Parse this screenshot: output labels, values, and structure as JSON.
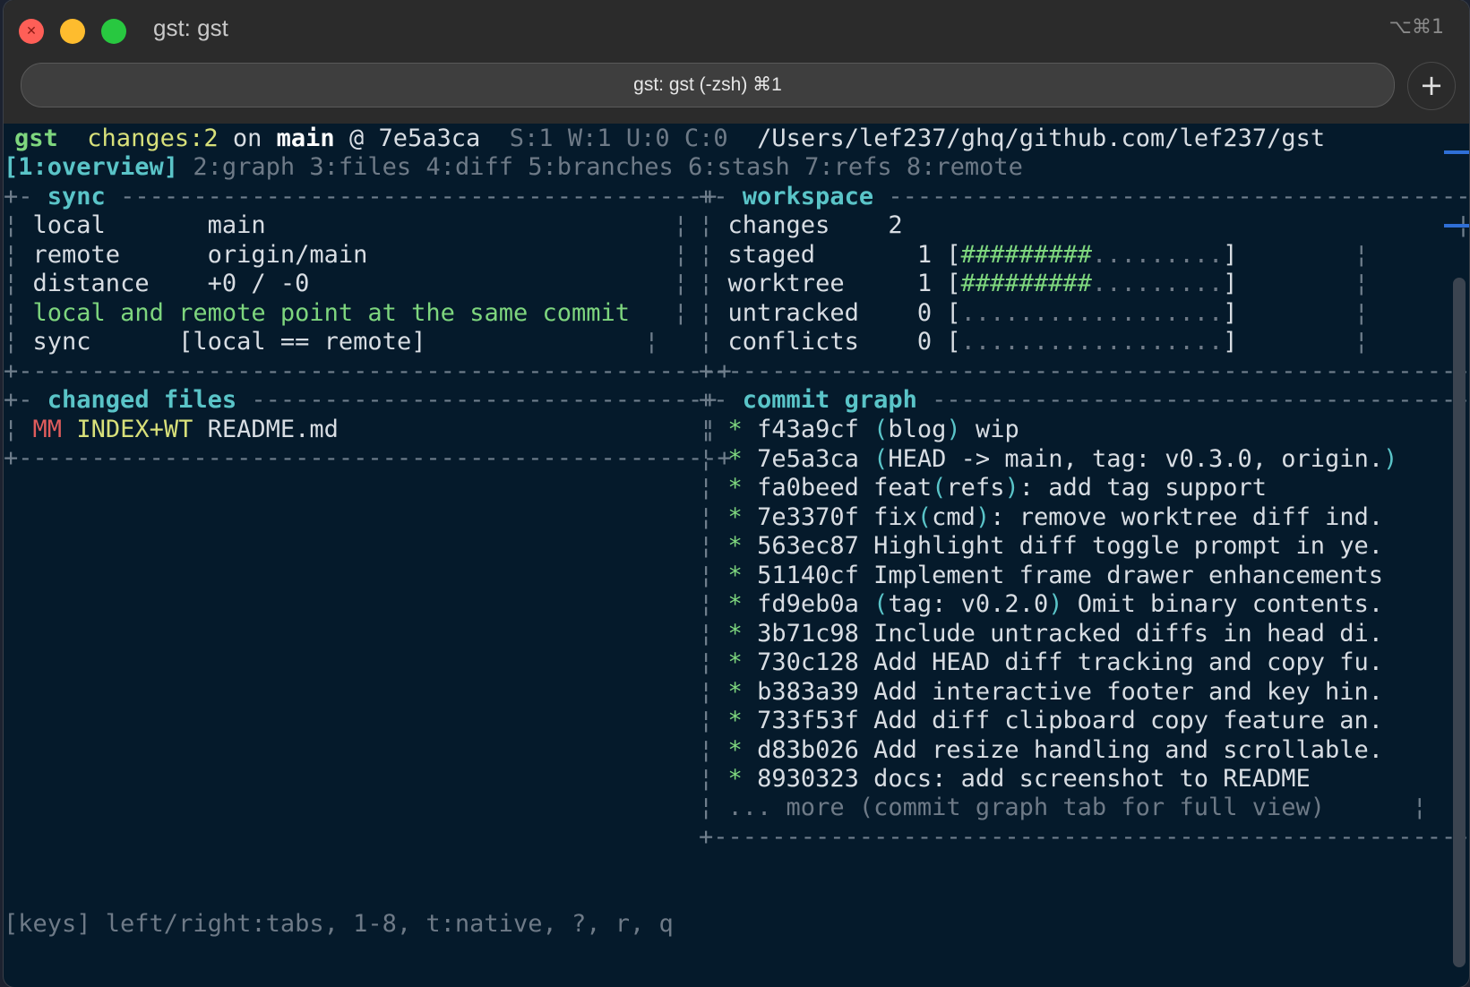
{
  "window": {
    "title": "gst: gst",
    "shortcut": "⌥⌘1",
    "tab_label": "gst: gst (-zsh) ⌘1",
    "new_tab": "+"
  },
  "status": {
    "app": "gst",
    "changes": "changes:2",
    "on": "on",
    "branch": "main",
    "at": "@",
    "commit": "7e5a3ca",
    "counts": "S:1 W:1 U:0 C:0",
    "path": "/Users/lef237/ghq/github.com/lef237/gst"
  },
  "tabs": {
    "active": "[1:overview]",
    "inactive": "2:graph 3:files 4:diff 5:branches 6:stash 7:refs 8:remote"
  },
  "sync": {
    "title": "sync",
    "rows": [
      {
        "key": "local",
        "value": "main"
      },
      {
        "key": "remote",
        "value": "origin/main"
      },
      {
        "key": "distance",
        "value": "+0 / -0"
      }
    ],
    "message": "local and remote point at the same commit",
    "sync_key": "sync",
    "sync_value": "[local == remote]"
  },
  "workspace": {
    "title": "workspace",
    "changes_key": "changes",
    "changes_value": "2",
    "bars": [
      {
        "key": "staged",
        "count": "1",
        "fill": "#########",
        "empty": ".........",
        "fraction": 0.5
      },
      {
        "key": "worktree",
        "count": "1",
        "fill": "#########",
        "empty": ".........",
        "fraction": 0.5
      },
      {
        "key": "untracked",
        "count": "0",
        "fill": "",
        "empty": "..................",
        "fraction": 0
      },
      {
        "key": "conflicts",
        "count": "0",
        "fill": "",
        "empty": "..................",
        "fraction": 0
      }
    ]
  },
  "changed_files": {
    "title": "changed files",
    "rows": [
      {
        "status": "MM",
        "kind": "INDEX+WT",
        "file": "README.md"
      }
    ]
  },
  "commit_graph": {
    "title": "commit graph",
    "commits": [
      {
        "hash": "f43a9cf",
        "pre": "",
        "ref": "blog",
        "post": " wip"
      },
      {
        "hash": "7e5a3ca",
        "pre": "",
        "ref": "HEAD -> main, tag: v0.3.0, origin.",
        "post": ""
      },
      {
        "hash": "fa0beed",
        "pre": "feat",
        "ref": "refs",
        "post": ": add tag support"
      },
      {
        "hash": "7e3370f",
        "pre": "fix",
        "ref": "cmd",
        "post": ": remove worktree diff ind."
      },
      {
        "hash": "563ec87",
        "pre": "",
        "ref": "",
        "post": "Highlight diff toggle prompt in ye."
      },
      {
        "hash": "51140cf",
        "pre": "",
        "ref": "",
        "post": "Implement frame drawer enhancements"
      },
      {
        "hash": "fd9eb0a",
        "pre": "",
        "ref": "tag: v0.2.0",
        "post": " Omit binary contents."
      },
      {
        "hash": "3b71c98",
        "pre": "",
        "ref": "",
        "post": "Include untracked diffs in head di."
      },
      {
        "hash": "730c128",
        "pre": "",
        "ref": "",
        "post": "Add HEAD diff tracking and copy fu."
      },
      {
        "hash": "b383a39",
        "pre": "",
        "ref": "",
        "post": "Add interactive footer and key hin."
      },
      {
        "hash": "733f53f",
        "pre": "",
        "ref": "",
        "post": "Add diff clipboard copy feature an."
      },
      {
        "hash": "d83b026",
        "pre": "",
        "ref": "",
        "post": "Add resize handling and scrollable."
      },
      {
        "hash": "8930323",
        "pre": "",
        "ref": "",
        "post": "docs: add screenshot to README"
      }
    ],
    "more": "... more (commit graph tab for full view)"
  },
  "footer": {
    "keys": "[keys] left/right:tabs, 1-8, t:native, ?, r, q"
  },
  "colors": {
    "background": "#051a2b",
    "green": "#7ed67e",
    "cyan": "#5ac4c8",
    "dim": "#6e7a87",
    "red": "#e05c5c"
  }
}
